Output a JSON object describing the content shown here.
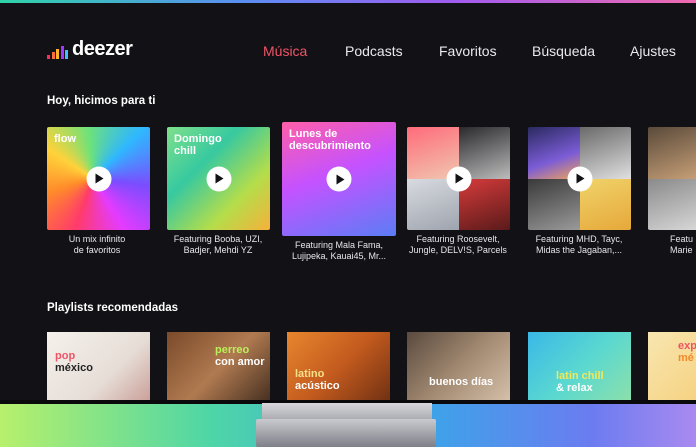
{
  "app": {
    "logo_text": "deezer"
  },
  "nav": {
    "items": [
      {
        "label": "Música",
        "active": true
      },
      {
        "label": "Podcasts"
      },
      {
        "label": "Favoritos"
      },
      {
        "label": "Búsqueda"
      },
      {
        "label": "Ajustes"
      }
    ]
  },
  "sections": {
    "made_for_you": {
      "title": "Hoy, hicimos para ti",
      "cards": [
        {
          "title": "flow",
          "caption": [
            "Un mix infinito",
            "de favoritos"
          ]
        },
        {
          "title": "Domingo chill",
          "caption": [
            "Featuring Booba, UZI,",
            "Badjer, Mehdi YZ"
          ]
        },
        {
          "title": "Lunes de descubrimiento",
          "caption": [
            "Featuring Mala Fama,",
            "Lujipeka, Kauai45, Mr..."
          ]
        },
        {
          "title": "",
          "caption": [
            "Featuring Roosevelt,",
            "Jungle, DELV!S, Parcels"
          ]
        },
        {
          "title": "",
          "caption": [
            "Featuring MHD, Tayc,",
            "Midas the Jagaban,..."
          ]
        },
        {
          "title": "",
          "caption": [
            "Featu",
            "Marie"
          ]
        }
      ]
    },
    "recommended": {
      "title": "Playlists recomendadas",
      "playlists": [
        {
          "line1": "pop",
          "line2": "méxico"
        },
        {
          "line1": "perreo",
          "line2": "con amor"
        },
        {
          "line1": "latino",
          "line2": "acústico"
        },
        {
          "line1": "buenos días",
          "line2": ""
        },
        {
          "line1": "latin chill",
          "line2": "& relax"
        },
        {
          "line1": "expl",
          "line2": "mé"
        }
      ]
    }
  },
  "colors": {
    "accent": "#ef5466",
    "background": "#121216"
  },
  "icons": [
    "play-icon",
    "deezer-equalizer-logo-icon"
  ]
}
